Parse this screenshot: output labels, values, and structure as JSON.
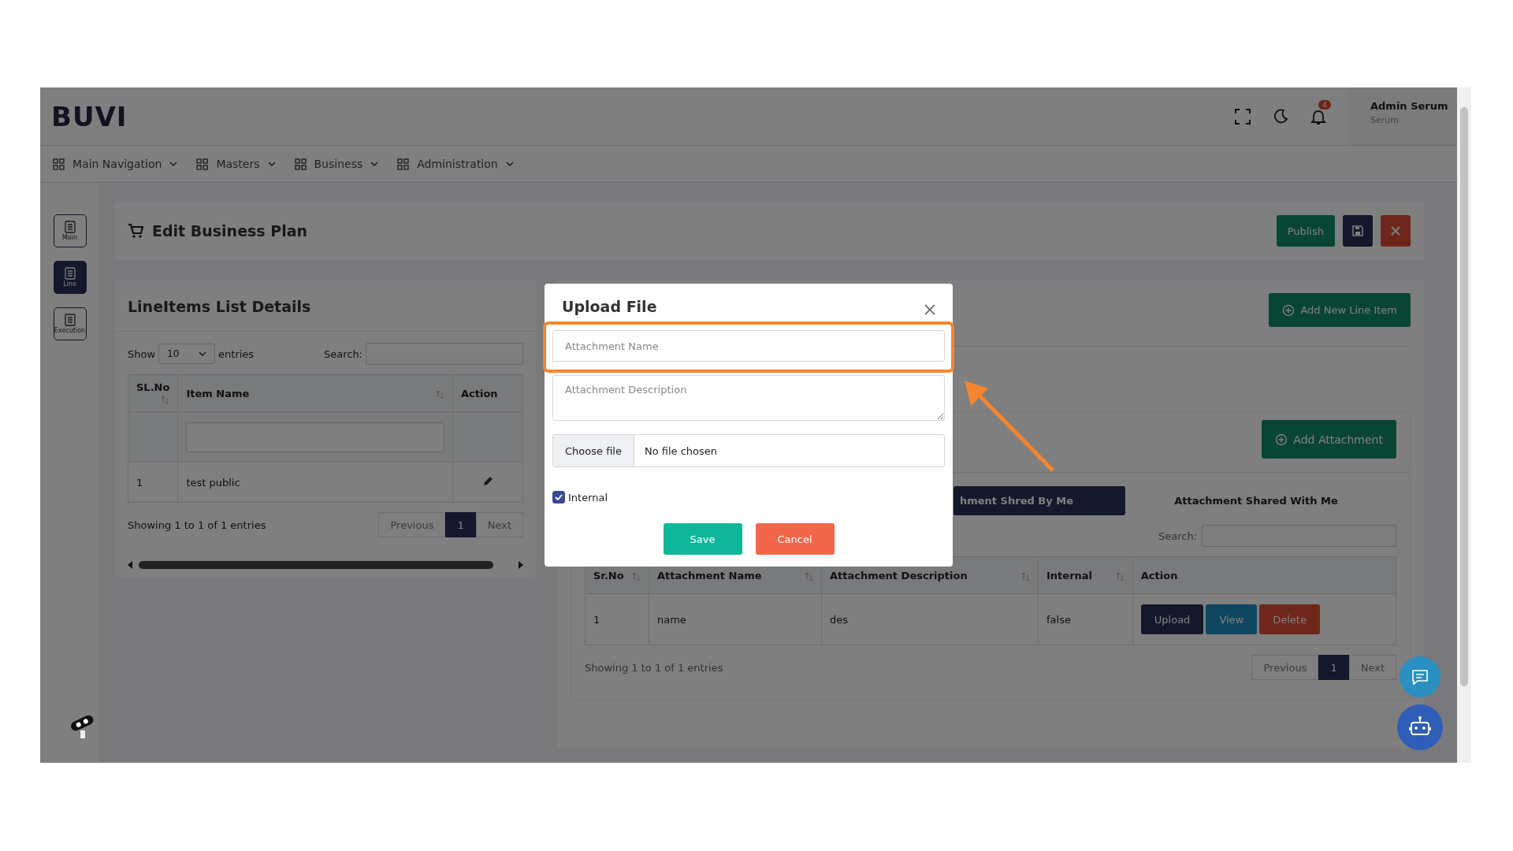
{
  "header": {
    "logo": "BUVI",
    "notification_count": "4",
    "user_name": "Admin Serum",
    "user_role": "Serum"
  },
  "nav": [
    {
      "label": "Main Navigation"
    },
    {
      "label": "Masters"
    },
    {
      "label": "Business"
    },
    {
      "label": "Administration"
    }
  ],
  "side_tabs": [
    {
      "label": "Main",
      "selected": false
    },
    {
      "label": "Line",
      "selected": true
    },
    {
      "label": "Execution",
      "selected": false
    }
  ],
  "page": {
    "title": "Edit Business Plan",
    "publish": "Publish"
  },
  "line_items": {
    "title": "LineItems List Details",
    "show": "Show",
    "page_size": "10",
    "entries": "entries",
    "search_label": "Search:",
    "columns": [
      {
        "label": "SL.No",
        "sortable": true
      },
      {
        "label": "Item Name",
        "sortable": true
      },
      {
        "label": "Action",
        "sortable": false
      }
    ],
    "rows": [
      {
        "cells": [
          "1",
          "test public"
        ]
      }
    ],
    "summary": "Showing 1 to 1 of 1 entries",
    "previous": "Previous",
    "pages": [
      {
        "label": "1",
        "selected": true
      }
    ],
    "next": "Next"
  },
  "attachments": {
    "add_line_item": "Add New Line Item",
    "add_attachment": "Add Attachment",
    "tabs": [
      {
        "label": "hment Shred By Me",
        "selected": true
      },
      {
        "label": "Attachment Shared With Me",
        "selected": false
      }
    ],
    "search_label": "Search:",
    "columns": [
      {
        "label": "Sr.No",
        "sortable": true
      },
      {
        "label": "Attachment Name",
        "sortable": true
      },
      {
        "label": "Attachment Description",
        "sortable": true
      },
      {
        "label": "Internal",
        "sortable": true
      },
      {
        "label": "Action",
        "sortable": false
      }
    ],
    "rows": [
      {
        "cells": [
          "1",
          "name",
          "des",
          "false"
        ],
        "actions": [
          {
            "label": "Upload",
            "kind": "upload"
          },
          {
            "label": "View",
            "kind": "view"
          },
          {
            "label": "Delete",
            "kind": "delete"
          }
        ]
      }
    ],
    "summary": "Showing 1 to 1 of 1 entries",
    "previous": "Previous",
    "pages": [
      {
        "label": "1",
        "selected": true
      }
    ],
    "next": "Next"
  },
  "modal": {
    "title": "Upload File",
    "name_placeholder": "Attachment Name",
    "name_highlighted": true,
    "description_placeholder": "Attachment Description",
    "choose_file": "Choose file",
    "file_status": "No file chosen",
    "internal": {
      "label": "Internal",
      "checked": true
    },
    "save": "Save",
    "cancel": "Cancel"
  }
}
